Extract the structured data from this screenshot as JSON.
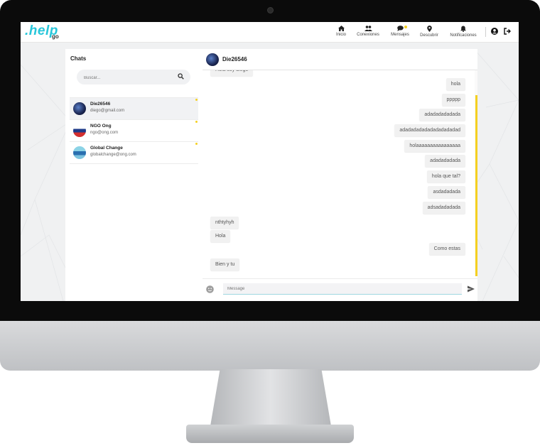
{
  "app": {
    "logo_text": ".help",
    "logo_sub": "go"
  },
  "nav": [
    {
      "label": "Inicio",
      "icon": "home-icon"
    },
    {
      "label": "Conexiones",
      "icon": "people-icon"
    },
    {
      "label": "Mensajes",
      "icon": "chat-icon",
      "badge": true
    },
    {
      "label": "Descubrir",
      "icon": "location-pin-icon"
    },
    {
      "label": "Notificaciones",
      "icon": "bell-icon"
    }
  ],
  "chats": {
    "title": "Chats",
    "search_placeholder": "Buscar...",
    "items": [
      {
        "name": "Die26546",
        "email": "diego@gmail.com",
        "active": true
      },
      {
        "name": "NGO Ong",
        "email": "ngo@ong.com",
        "active": false
      },
      {
        "name": "Global Change",
        "email": "globalchange@ong.com",
        "active": false
      }
    ]
  },
  "conversation": {
    "contact": "Die26546",
    "messages": [
      {
        "text": "Hola soy diego",
        "dir": "in"
      },
      {
        "text": "hola",
        "dir": "out"
      },
      {
        "text": "ppppp",
        "dir": "out"
      },
      {
        "text": "adadadadadada",
        "dir": "out"
      },
      {
        "text": "adadadadadadadadadadad",
        "dir": "out"
      },
      {
        "text": "holaaaaaaaaaaaaaaaa",
        "dir": "out"
      },
      {
        "text": "adadadadada",
        "dir": "out"
      },
      {
        "text": "hola que tal?",
        "dir": "out"
      },
      {
        "text": "asdadadada",
        "dir": "out"
      },
      {
        "text": "adsadadadada",
        "dir": "out"
      },
      {
        "text": "nthtyhyh",
        "dir": "in"
      },
      {
        "text": "Hola",
        "dir": "in"
      },
      {
        "text": "Como estas",
        "dir": "out"
      },
      {
        "text": "Bien y tu",
        "dir": "in"
      }
    ],
    "input_placeholder": "Message"
  },
  "colors": {
    "accent": "#26c6da",
    "highlight": "#f5d020"
  }
}
